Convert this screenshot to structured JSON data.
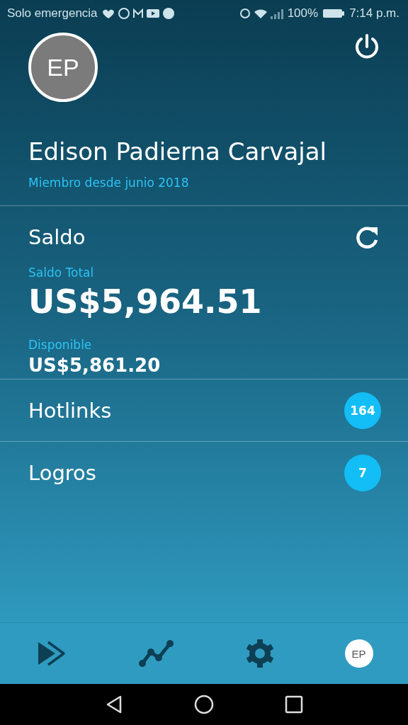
{
  "status_bar": {
    "carrier": "Solo emergencia",
    "battery": "100%",
    "time": "7:14 p.m."
  },
  "profile": {
    "initials": "EP",
    "name": "Edison Padierna Carvajal",
    "member_since": "Miembro desde junio 2018"
  },
  "balance": {
    "title": "Saldo",
    "total_label": "Saldo Total",
    "total": "US$5,964.51",
    "available_label": "Disponible",
    "available": "US$5,861.20"
  },
  "rows": [
    {
      "label": "Hotlinks",
      "count": "164"
    },
    {
      "label": "Logros",
      "count": "7"
    }
  ],
  "bottom_nav": {
    "avatar_initials": "EP"
  }
}
